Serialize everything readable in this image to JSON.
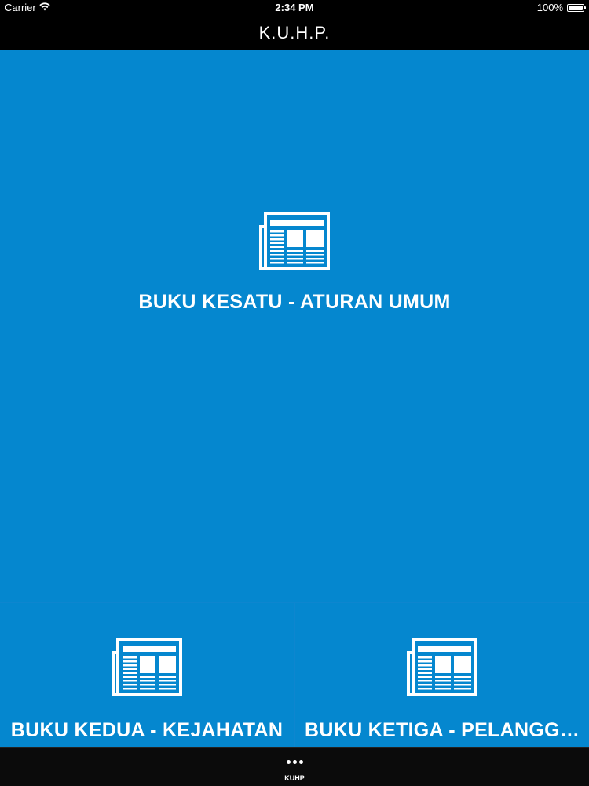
{
  "status_bar": {
    "carrier": "Carrier",
    "time": "2:34 PM",
    "battery_text": "100%",
    "battery_level": 1.0,
    "wifi_icon": "wifi-icon",
    "battery_icon": "battery-icon"
  },
  "nav": {
    "title": "K.U.H.P."
  },
  "tiles": [
    {
      "label": "BUKU KESATU - ATURAN UMUM",
      "icon": "newspaper-icon"
    },
    {
      "label": "BUKU KEDUA - KEJAHATAN",
      "icon": "newspaper-icon"
    },
    {
      "label": "BUKU KETIGA - PELANGGARAN",
      "icon": "newspaper-icon"
    }
  ],
  "tab_bar": {
    "items": [
      {
        "label": "KUHP",
        "icon": "more-dots-icon"
      }
    ]
  },
  "colors": {
    "tile_background": "#0587cf",
    "bar_background": "#000000",
    "text": "#ffffff"
  }
}
